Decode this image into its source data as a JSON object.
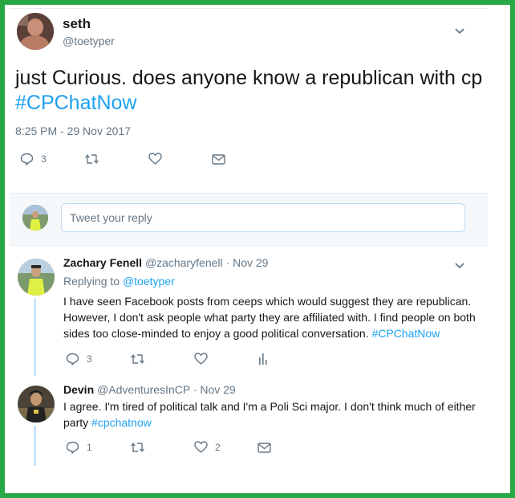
{
  "colors": {
    "frame": "#27a844",
    "accent": "#1da1f2",
    "muted": "#657786",
    "text": "#14171a",
    "thread": "#c8e4f9"
  },
  "main_tweet": {
    "name": "seth",
    "handle": "@toetyper",
    "text_plain": "just  Curious. does anyone know a republican with cp ",
    "hashtag": "#CPChatNow",
    "timestamp": "8:25 PM - 29 Nov 2017",
    "actions": {
      "reply_count": "3",
      "icons": [
        "reply-icon",
        "retweet-icon",
        "like-icon",
        "message-icon"
      ]
    }
  },
  "composer": {
    "placeholder": "Tweet your reply"
  },
  "replies": [
    {
      "name": "Zachary Fenell",
      "handle": "@zacharyfenell",
      "date": "· Nov 29",
      "replying_label": "Replying to",
      "replying_to": "@toetyper",
      "text_plain": "I have seen Facebook posts from ceeps which would suggest they are republican. However, I don't ask people what party they are affiliated with. I find people on both sides too close-minded to enjoy a good political conversation. ",
      "hashtag": "#CPChatNow",
      "reply_count": "3",
      "icons": [
        "reply-icon",
        "retweet-icon",
        "like-icon",
        "analytics-icon"
      ]
    },
    {
      "name": "Devin",
      "handle": "@AdventuresInCP",
      "date": "· Nov 29",
      "text_plain": "I agree. I'm tired of political talk and I'm a Poli Sci major. I don't think much of either party ",
      "hashtag": "#cpchatnow",
      "reply_count": "1",
      "like_count": "2",
      "icons": [
        "reply-icon",
        "retweet-icon",
        "like-icon",
        "message-icon"
      ]
    }
  ]
}
